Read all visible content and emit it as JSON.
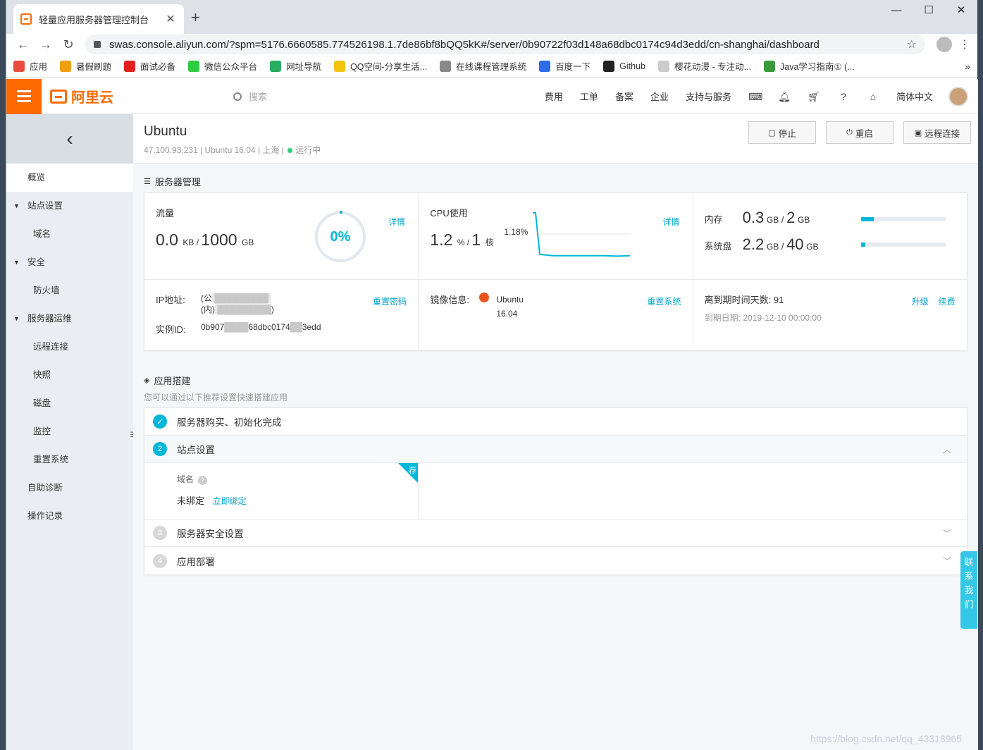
{
  "browser": {
    "tab_title": "轻量应用服务器管理控制台",
    "url": "swas.console.aliyun.com/?spm=5176.6660585.774526198.1.7de86bf8bQQ5kK#/server/0b90722f03d148a68dbc0174c94d3edd/cn-shanghai/dashboard",
    "bookmarks": [
      {
        "label": "应用",
        "color": "#e74c3c"
      },
      {
        "label": "暑假刷题",
        "color": "#f39c12"
      },
      {
        "label": "面试必备",
        "color": "#e02020"
      },
      {
        "label": "微信公众平台",
        "color": "#2ecc40"
      },
      {
        "label": "网址导航",
        "color": "#27ae60"
      },
      {
        "label": "QQ空间-分享生活...",
        "color": "#f1c40f"
      },
      {
        "label": "在线课程管理系统",
        "color": "#888888"
      },
      {
        "label": "百度一下",
        "color": "#2e6be6"
      },
      {
        "label": "Github",
        "color": "#222222"
      },
      {
        "label": "樱花动漫 - 专注动...",
        "color": "#cccccc"
      },
      {
        "label": "Java学习指南① (...",
        "color": "#3a9a3a"
      }
    ]
  },
  "header": {
    "logo": "阿里云",
    "search_placeholder": "搜索",
    "nav": [
      "费用",
      "工单",
      "备案",
      "企业",
      "支持与服务"
    ],
    "lang": "简体中文"
  },
  "sidebar": {
    "items": [
      {
        "label": "概览",
        "kind": "top",
        "active": true
      },
      {
        "label": "站点设置",
        "kind": "group"
      },
      {
        "label": "域名",
        "kind": "sub"
      },
      {
        "label": "安全",
        "kind": "group"
      },
      {
        "label": "防火墙",
        "kind": "sub"
      },
      {
        "label": "服务器运维",
        "kind": "group"
      },
      {
        "label": "远程连接",
        "kind": "sub"
      },
      {
        "label": "快照",
        "kind": "sub"
      },
      {
        "label": "磁盘",
        "kind": "sub"
      },
      {
        "label": "监控",
        "kind": "sub"
      },
      {
        "label": "重置系统",
        "kind": "sub"
      },
      {
        "label": "自助诊断",
        "kind": "top"
      },
      {
        "label": "操作记录",
        "kind": "top"
      }
    ]
  },
  "page": {
    "title": "Ubuntu",
    "ip": "47.100.93.231",
    "os": "Ubuntu 16.04",
    "region": "上海",
    "status": "运行中",
    "buttons": {
      "stop": "停止",
      "restart": "重启",
      "remote": "远程连接"
    }
  },
  "server_mgmt": {
    "title": "服务器管理",
    "traffic": {
      "label": "流量",
      "used": "0.0",
      "used_unit": "KB",
      "total": "1000",
      "total_unit": "GB",
      "percent": "0%",
      "link": "详情"
    },
    "cpu": {
      "label": "CPU使用",
      "used": "1.2",
      "used_unit": "%",
      "total": "1",
      "total_unit": "核",
      "peak": "1.18%",
      "link": "详情",
      "series": [
        100,
        100,
        8,
        5,
        5,
        5,
        5,
        5,
        4,
        5
      ]
    },
    "memory": {
      "label": "内存",
      "used": "0.3",
      "total": "2",
      "unit": "GB",
      "fraction": 0.15
    },
    "disk": {
      "label": "系统盘",
      "used": "2.2",
      "total": "40",
      "unit": "GB",
      "fraction": 0.055
    },
    "ip_label": "IP地址:",
    "ip_public": "(公",
    "ip_private": "(内)",
    "ip_tail": ")",
    "reset_pwd": "重置密码",
    "instance_label": "实例ID:",
    "instance_id_head": "0b907",
    "instance_id_mid": "68dbc0174",
    "instance_id_tail": "3edd",
    "image_label": "镜像信息:",
    "image_name": "Ubuntu",
    "image_version": "16.04",
    "reset_sys": "重置系统",
    "expire_days_label": "离到期时间天数:",
    "expire_days": "91",
    "expire_date_label": "到期日期:",
    "expire_date": "2019-12-10 00:00:00",
    "upgrade": "升级",
    "renew": "续费"
  },
  "app_build": {
    "title": "应用搭建",
    "subtitle": "您可以通过以下推荐设置快速搭建应用",
    "steps": [
      {
        "num": "✓",
        "label": "服务器购买、初始化完成",
        "state": "done"
      },
      {
        "num": "2",
        "label": "站点设置",
        "state": "cur"
      },
      {
        "num": "3",
        "label": "服务器安全设置",
        "state": "todo"
      },
      {
        "num": "4",
        "label": "应用部署",
        "state": "todo"
      }
    ],
    "domain_label": "域名",
    "domain_status": "未绑定",
    "bind_now": "立即绑定",
    "recommend": "荐"
  },
  "contact": "联系我们",
  "watermark": "https://blog.csdn.net/qq_43318965"
}
